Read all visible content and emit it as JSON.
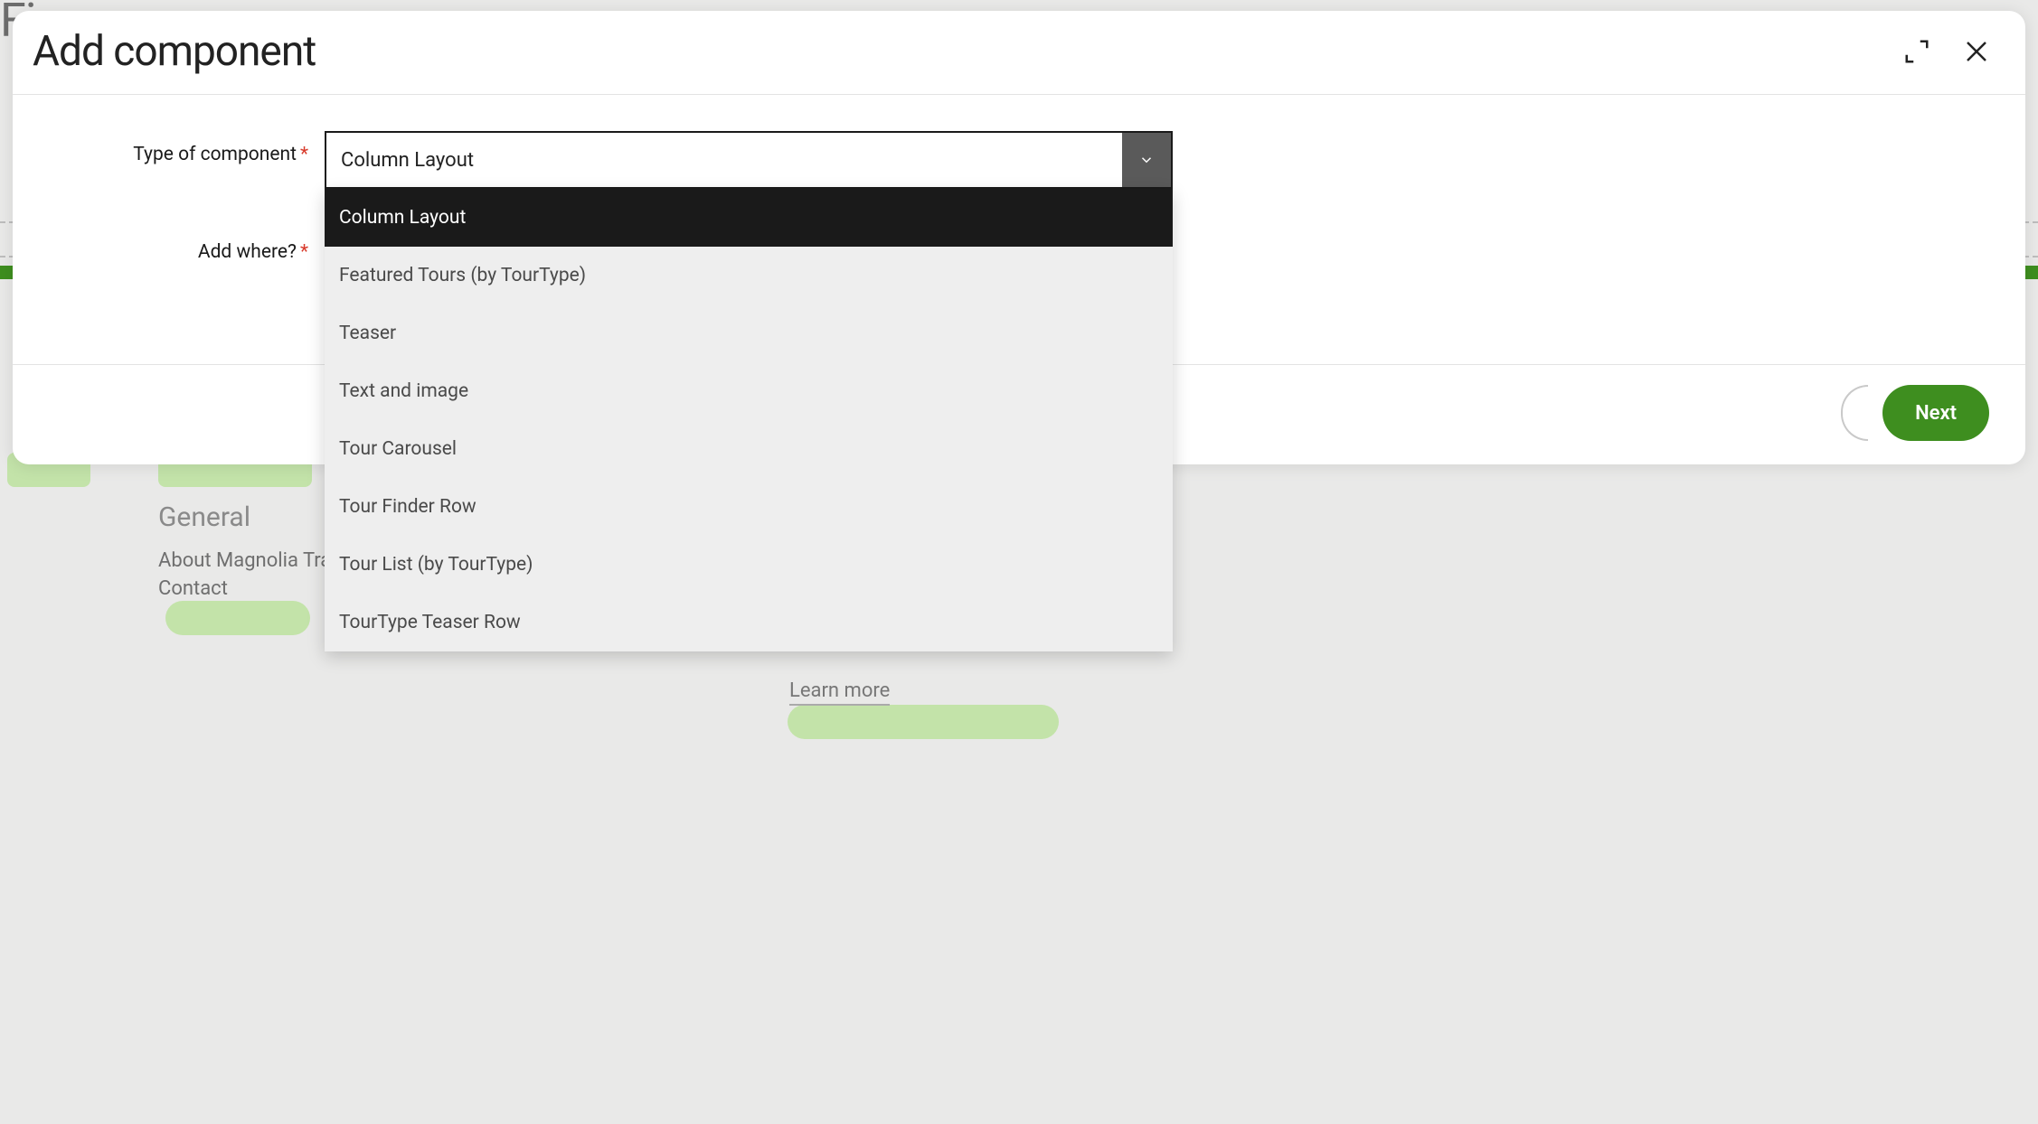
{
  "background": {
    "top_text": "Fin",
    "footer": {
      "heading": "General",
      "link1": "About Magnolia Tra",
      "link2": "Contact",
      "learn_more": "Learn more"
    }
  },
  "modal": {
    "title": "Add component",
    "fields": {
      "type_label": "Type of component",
      "type_value": "Column Layout",
      "where_label": "Add where?"
    },
    "dropdown": {
      "options": [
        "Column Layout",
        "Featured Tours (by TourType)",
        "Teaser",
        "Text and image",
        "Tour Carousel",
        "Tour Finder Row",
        "Tour List (by TourType)",
        "TourType Teaser Row"
      ]
    },
    "actions": {
      "next": "Next"
    }
  }
}
